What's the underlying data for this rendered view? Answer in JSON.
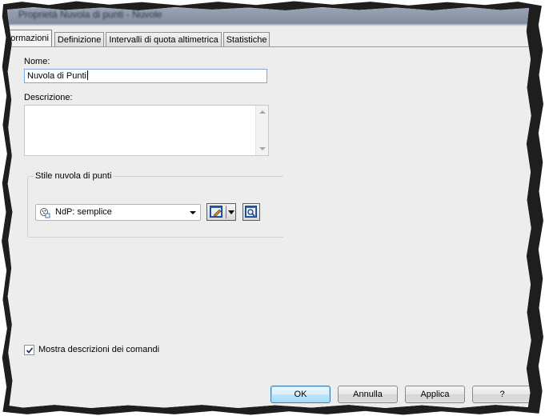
{
  "window": {
    "title": "Proprietà Nuvola di punti - Nuvole"
  },
  "tabs": [
    {
      "label": "Informazioni",
      "active": true
    },
    {
      "label": "Definizione",
      "active": false
    },
    {
      "label": "Intervalli di quota altimetrica",
      "active": false
    },
    {
      "label": "Statistiche",
      "active": false
    }
  ],
  "form": {
    "name_label": "Nome:",
    "name_value": "Nuvola di Punti",
    "description_label": "Descrizione:",
    "description_value": "",
    "style_group_label": "Stile nuvola di punti",
    "style_selected": "NdP: semplice",
    "tooltip_checkbox_label": "Mostra descrizioni dei comandi",
    "tooltip_checkbox_checked": true
  },
  "buttons": {
    "ok": "OK",
    "cancel": "Annulla",
    "apply": "Applica",
    "help": "?"
  },
  "colors": {
    "accent": "#3c7fb1",
    "input_focus_border": "#7ea8d6",
    "dialog_bg": "#ededed"
  }
}
